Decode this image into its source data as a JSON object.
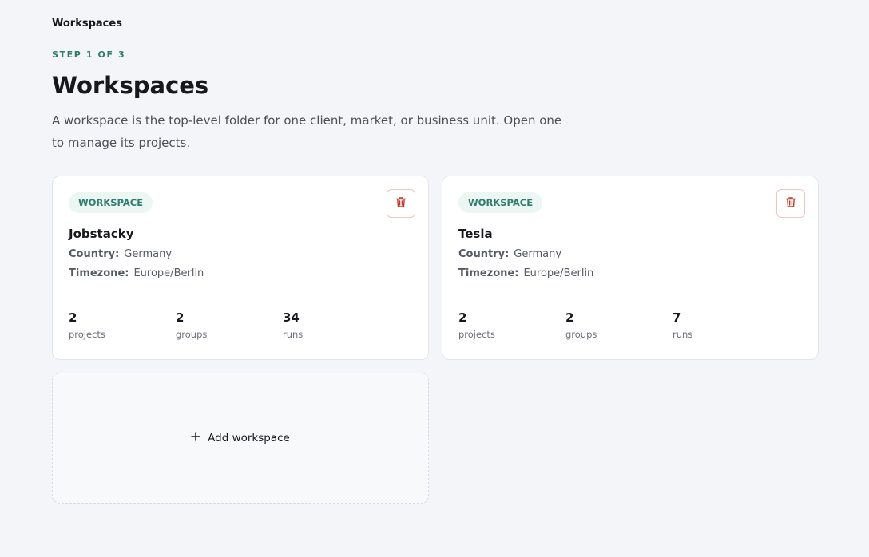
{
  "breadcrumb": "Workspaces",
  "step": "STEP 1 OF 3",
  "title": "Workspaces",
  "description": "A workspace is the top-level folder for one client, market, or business unit. Open one to manage its projects.",
  "workspaces": [
    {
      "badge": "WORKSPACE",
      "name": "Jobstacky",
      "country_label": "Country:",
      "country": "Germany",
      "timezone_label": "Timezone:",
      "timezone": "Europe/Berlin",
      "stats": [
        {
          "value": "2",
          "label": "projects"
        },
        {
          "value": "2",
          "label": "groups"
        },
        {
          "value": "34",
          "label": "runs"
        }
      ]
    },
    {
      "badge": "WORKSPACE",
      "name": "Tesla",
      "country_label": "Country:",
      "country": "Germany",
      "timezone_label": "Timezone:",
      "timezone": "Europe/Berlin",
      "stats": [
        {
          "value": "2",
          "label": "projects"
        },
        {
          "value": "2",
          "label": "groups"
        },
        {
          "value": "7",
          "label": "runs"
        }
      ]
    }
  ],
  "add_workspace_label": "Add workspace",
  "icons": {
    "delete": "trash-icon",
    "add": "plus-icon"
  },
  "colors": {
    "accent": "#2f7d6d",
    "badge_bg": "#ecf6f3",
    "danger": "#c0392b",
    "background": "#f4f5f8"
  }
}
